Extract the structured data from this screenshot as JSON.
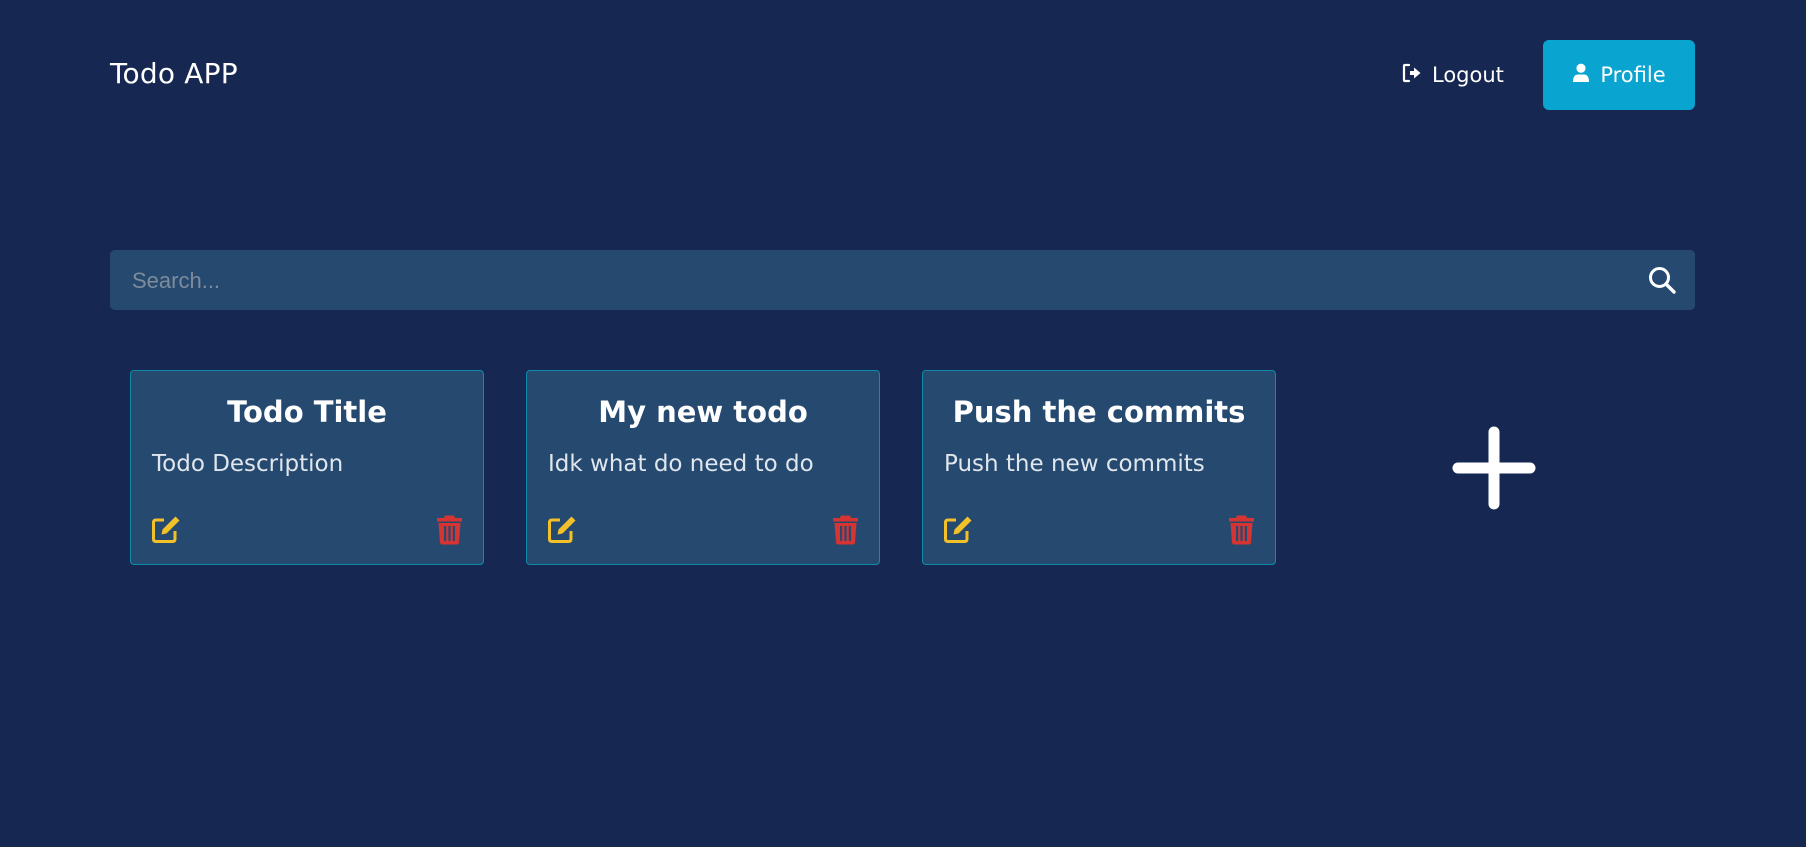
{
  "header": {
    "app_title": "Todo APP",
    "logout_label": "Logout",
    "profile_label": "Profile"
  },
  "search": {
    "placeholder": "Search...",
    "value": ""
  },
  "todos": [
    {
      "title": "Todo Title",
      "description": "Todo Description"
    },
    {
      "title": "My new todo",
      "description": "Idk what do need to do"
    },
    {
      "title": "Push the commits",
      "description": "Push the new commits"
    }
  ],
  "icons": {
    "logout": "logout-icon",
    "profile": "user-icon",
    "search": "search-icon",
    "edit": "edit-icon",
    "delete": "trash-icon",
    "add": "plus-icon"
  },
  "colors": {
    "background": "#162851",
    "surface": "#26496f",
    "accent": "#0aa4d1",
    "card_border": "#0e8ba8",
    "edit": "#f2c029",
    "delete": "#d63333"
  }
}
